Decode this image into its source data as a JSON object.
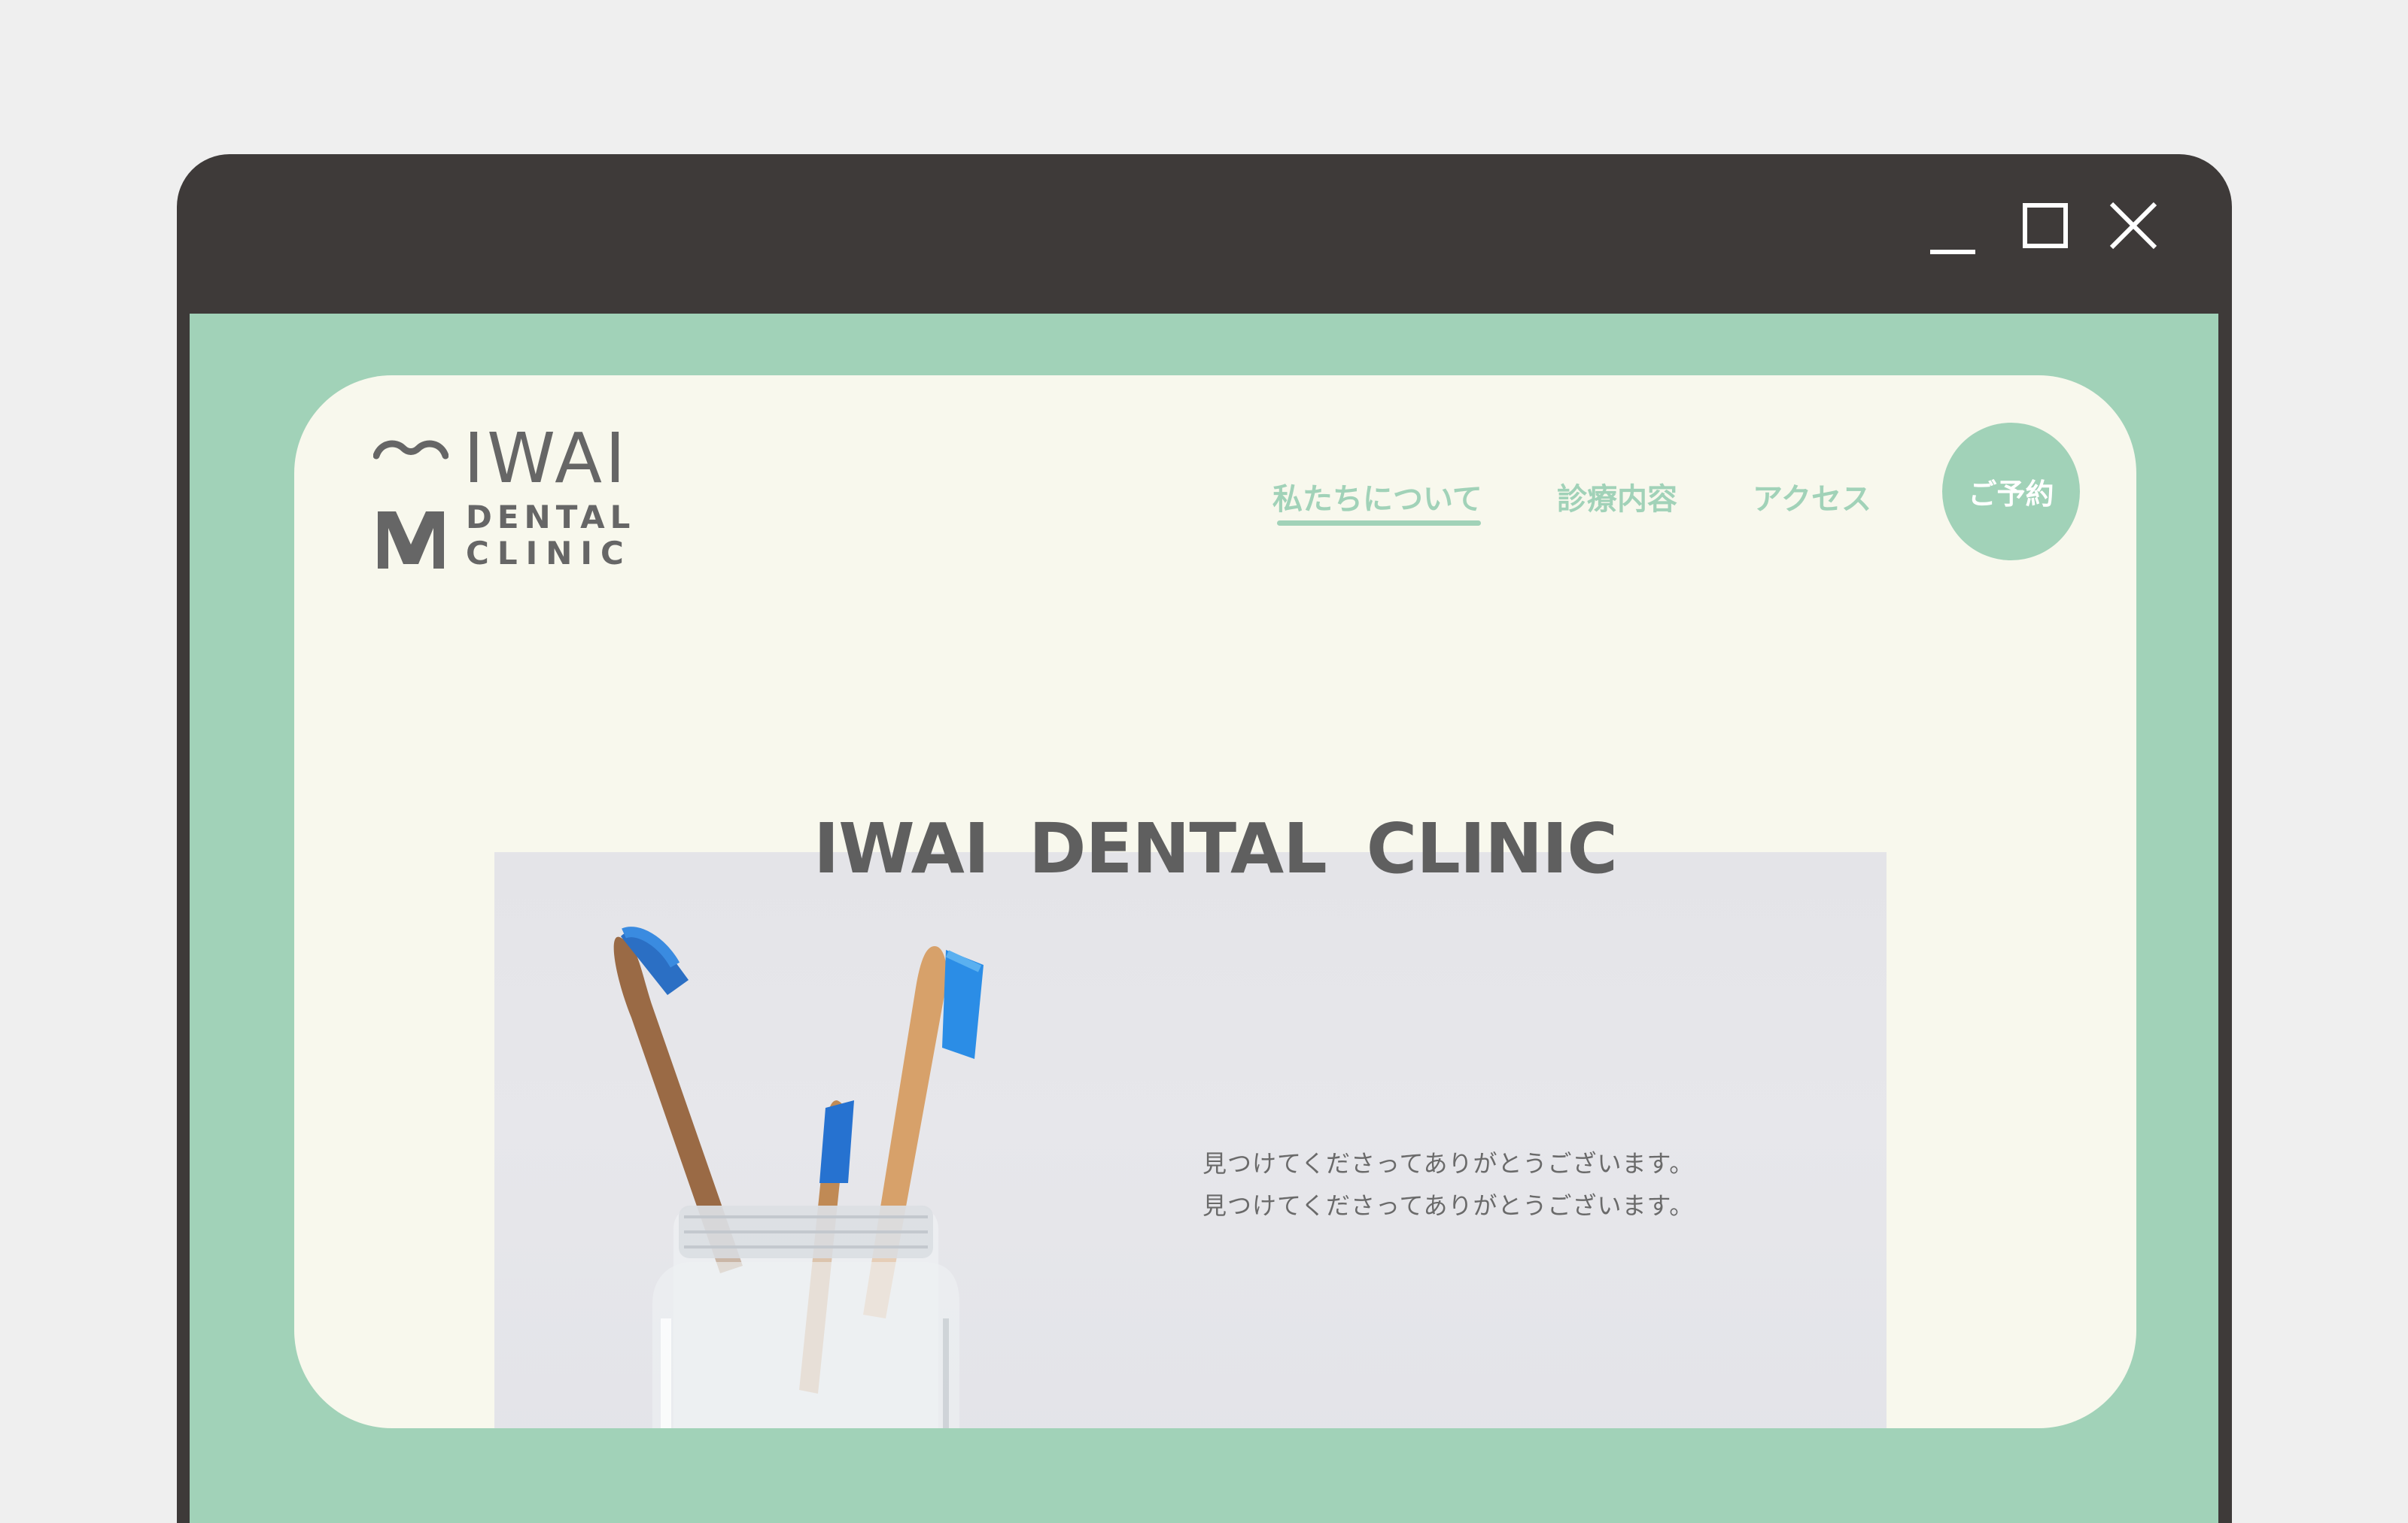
{
  "window": {
    "controls": {
      "minimize_icon": "minimize-icon",
      "maximize_icon": "maximize-icon",
      "close_icon": "close-icon"
    }
  },
  "colors": {
    "frame": "#3e3a39",
    "accent": "#a1d2b8",
    "card": "#f8f8ed",
    "text": "#666666"
  },
  "logo": {
    "line1": "IWAI",
    "line2": "DENTAL",
    "line3": "CLINIC"
  },
  "nav": {
    "items": [
      {
        "label": "私たちについて",
        "active": true
      },
      {
        "label": "診療内容",
        "active": false
      },
      {
        "label": "アクセス",
        "active": false
      }
    ],
    "reserve_label": "ご予約"
  },
  "hero": {
    "title": "IWAI  DENTAL  CLINIC",
    "lines": [
      "見つけてくださってありがとうございます。",
      "見つけてくださってありがとうございます。"
    ]
  }
}
